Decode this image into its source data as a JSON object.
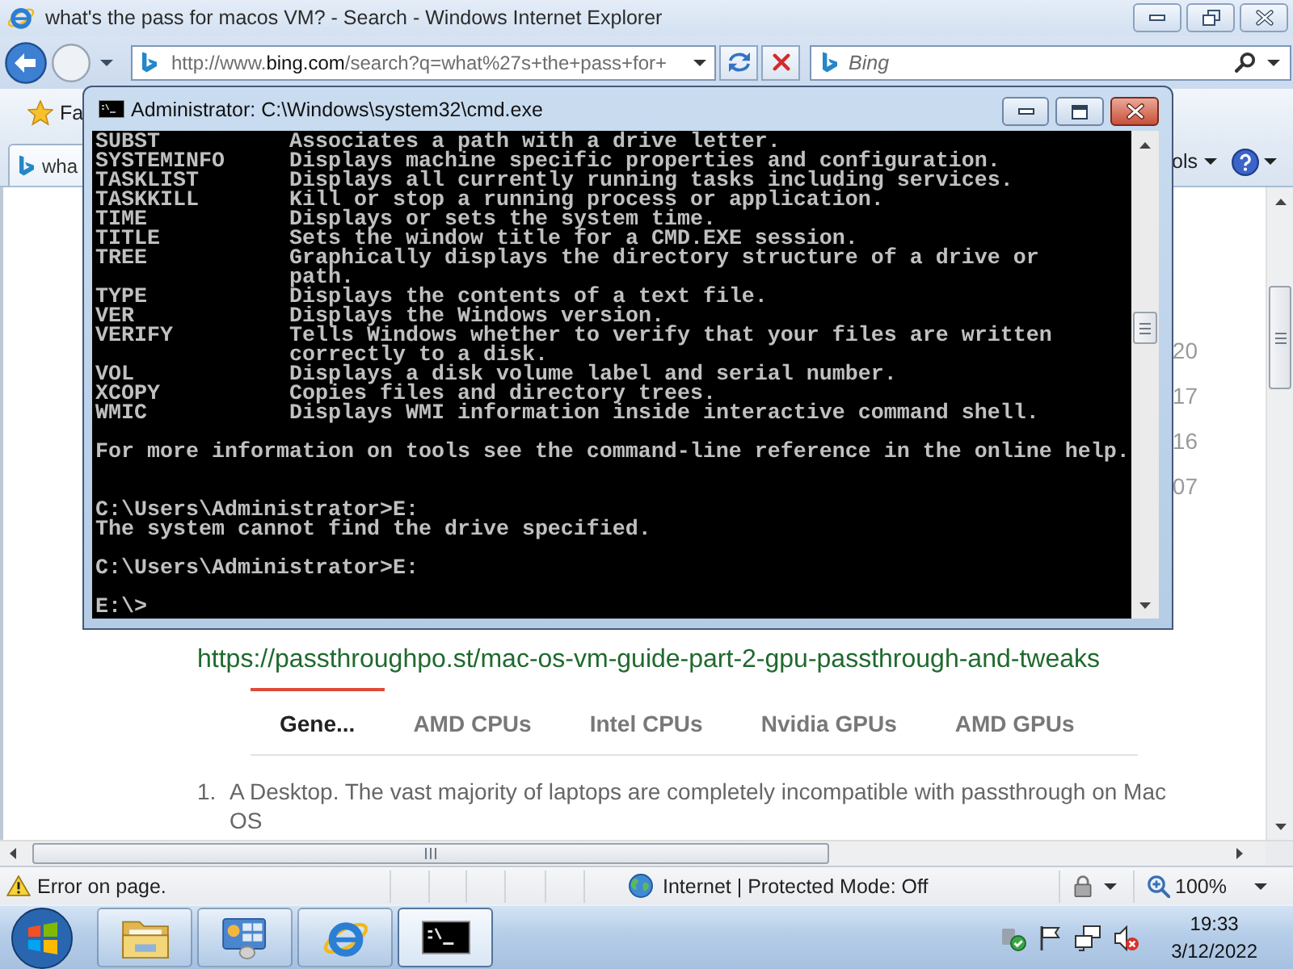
{
  "ie": {
    "title": "what's the pass for macos VM? - Search - Windows Internet Explorer",
    "address": "http://www.**bing.com**/search?q=what%27s+the+pass+for+",
    "search_placeholder": "Bing",
    "favorites_label": "Fa",
    "tab_label": "wha",
    "tools_label": "ols"
  },
  "cmd": {
    "title": "Administrator: C:\\Windows\\system32\\cmd.exe",
    "lines": [
      {
        "kind": "entry",
        "command": "SUBST",
        "description": "Associates a path with a drive letter."
      },
      {
        "kind": "entry",
        "command": "SYSTEMINFO",
        "description": "Displays machine specific properties and configuration."
      },
      {
        "kind": "entry",
        "command": "TASKLIST",
        "description": "Displays all currently running tasks including services."
      },
      {
        "kind": "entry",
        "command": "TASKKILL",
        "description": "Kill or stop a running process or application."
      },
      {
        "kind": "entry",
        "command": "TIME",
        "description": "Displays or sets the system time."
      },
      {
        "kind": "entry",
        "command": "TITLE",
        "description": "Sets the window title for a CMD.EXE session."
      },
      {
        "kind": "entry",
        "command": "TREE",
        "description": "Graphically displays the directory structure of a drive or path."
      },
      {
        "kind": "entry",
        "command": "TYPE",
        "description": "Displays the contents of a text file."
      },
      {
        "kind": "entry",
        "command": "VER",
        "description": "Displays the Windows version."
      },
      {
        "kind": "entry",
        "command": "VERIFY",
        "description": "Tells Windows whether to verify that your files are written correctly to a disk."
      },
      {
        "kind": "entry",
        "command": "VOL",
        "description": "Displays a disk volume label and serial number."
      },
      {
        "kind": "entry",
        "command": "XCOPY",
        "description": "Copies files and directory trees."
      },
      {
        "kind": "entry",
        "command": "WMIC",
        "description": "Displays WMI information inside interactive command shell."
      },
      {
        "kind": "blank"
      },
      {
        "kind": "text",
        "text": "For more information on tools see the command-line reference in the online help."
      },
      {
        "kind": "blank"
      },
      {
        "kind": "blank"
      },
      {
        "kind": "text",
        "text": "C:\\Users\\Administrator>E:"
      },
      {
        "kind": "text",
        "text": "The system cannot find the drive specified."
      },
      {
        "kind": "blank"
      },
      {
        "kind": "text",
        "text": "C:\\Users\\Administrator>E:"
      },
      {
        "kind": "blank"
      },
      {
        "kind": "text",
        "text": "E:\\>"
      }
    ]
  },
  "page": {
    "side_values": [
      "20",
      "17",
      "16",
      "07"
    ],
    "url": "https://passthroughpo.st/mac-os-vm-guide-part-2-gpu-passthrough-and-tweaks",
    "tabs": [
      {
        "label": "Gene...",
        "selected": true
      },
      {
        "label": "AMD CPUs",
        "selected": false
      },
      {
        "label": "Intel CPUs",
        "selected": false
      },
      {
        "label": "Nvidia GPUs",
        "selected": false
      },
      {
        "label": "AMD GPUs",
        "selected": false
      }
    ],
    "list": [
      {
        "number": "1.",
        "text": "A Desktop. The vast majority of laptops are completely incompatible with passthrough on Mac OS"
      }
    ]
  },
  "status_bar": {
    "message": "Error on page.",
    "zone": "Internet | Protected Mode: Off",
    "zoom": "100%"
  },
  "taskbar": {
    "apps": [
      {
        "kind": "explorer",
        "selected": false
      },
      {
        "kind": "control-panel",
        "selected": false
      },
      {
        "kind": "browser",
        "selected": false
      },
      {
        "kind": "terminal",
        "selected": true
      }
    ],
    "time": "19:33",
    "date": "3/12/2022"
  }
}
